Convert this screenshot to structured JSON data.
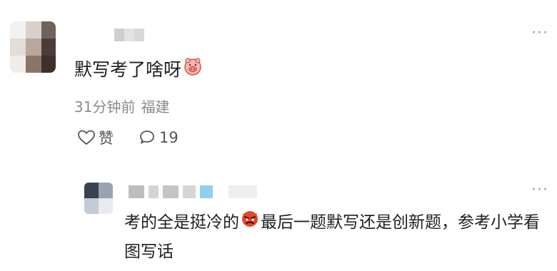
{
  "comment": {
    "text": "默写考了啥呀",
    "emoji_icon": "pig-emoji-icon",
    "time": "31分钟前",
    "location": "福建",
    "like_label": "赞",
    "reply_count": "19"
  },
  "reply": {
    "text_part1": "考的全是挺冷的",
    "emoji_icon": "angry-devil-emoji-icon",
    "text_part2": "最后一题默写还是创新题，参考小学看图写话"
  },
  "colors": {
    "meta_text": "#8a8a8a",
    "body_text": "#1f1f1f",
    "blur_gray": "#c8c8c8",
    "blur_blue": "#8fd0ee"
  }
}
